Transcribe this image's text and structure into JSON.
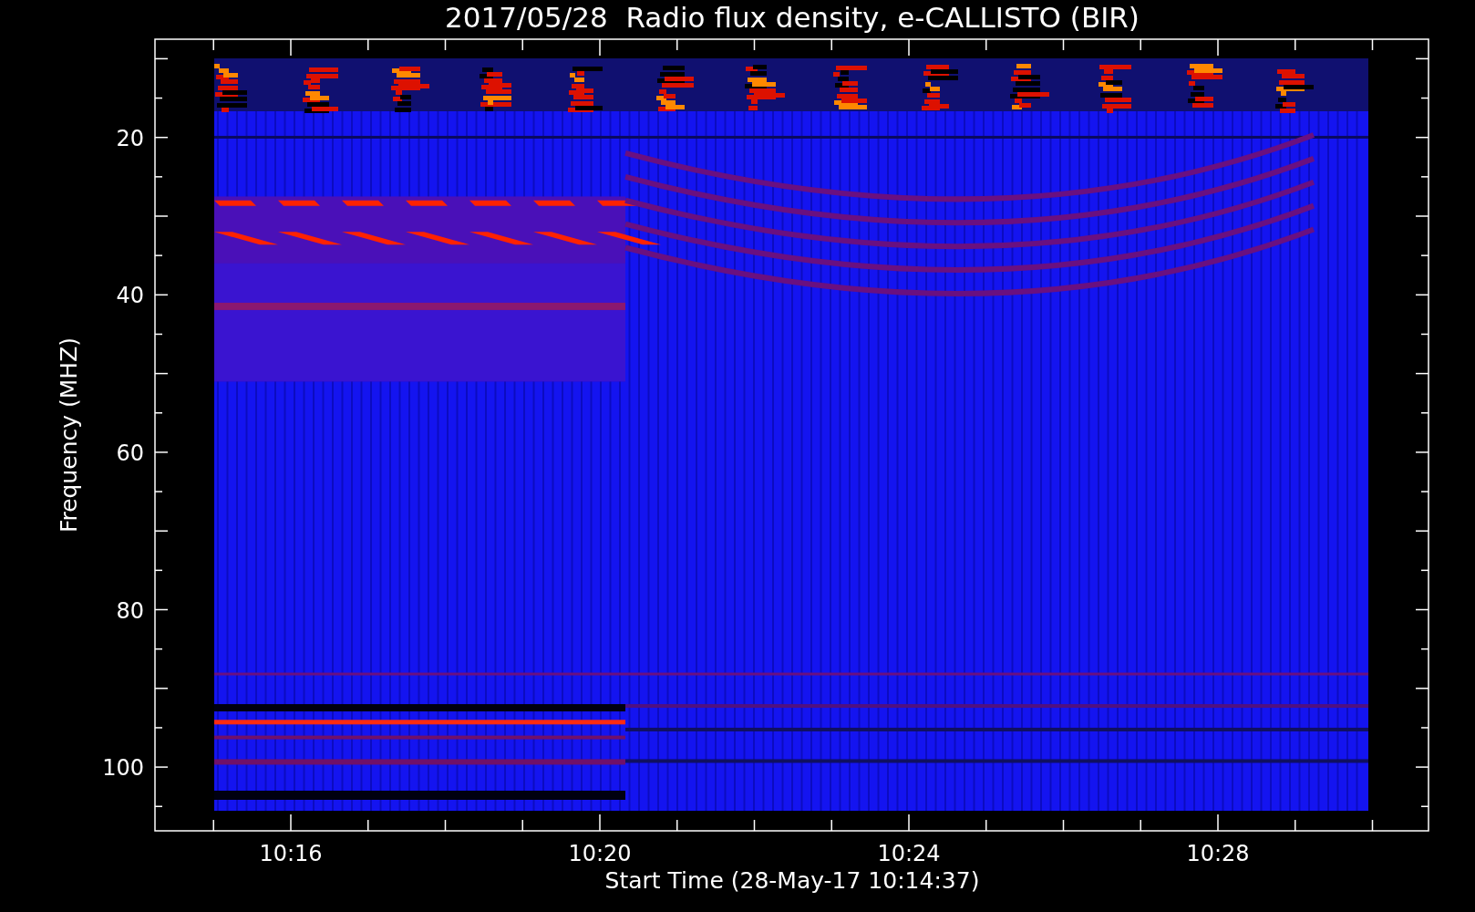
{
  "title": "2017/05/28  Radio flux density, e-CALLISTO (BIR)",
  "xlabel": "Start Time (28-May-17 10:14:37)",
  "ylabel": "Frequency (MHZ)",
  "xticks": [
    "10:16",
    "10:20",
    "10:24",
    "10:28"
  ],
  "yticks": [
    "20",
    "40",
    "60",
    "80",
    "100"
  ]
}
